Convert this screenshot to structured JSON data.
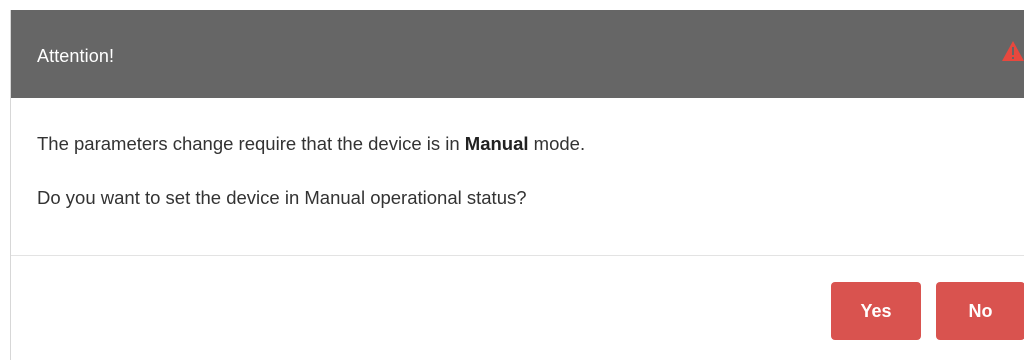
{
  "dialog": {
    "title": "Attention!",
    "header_bg": "#666666",
    "warning_icon": "warning-triangle-icon",
    "warning_color": "#e8483e",
    "line1_prefix": "The parameters change require that the device is in ",
    "line1_bold": "Manual",
    "line1_suffix": " mode.",
    "line2": "Do you want to set the device in Manual operational status?",
    "buttons": {
      "yes_label": "Yes",
      "no_label": "No",
      "color": "#d9534f"
    }
  }
}
